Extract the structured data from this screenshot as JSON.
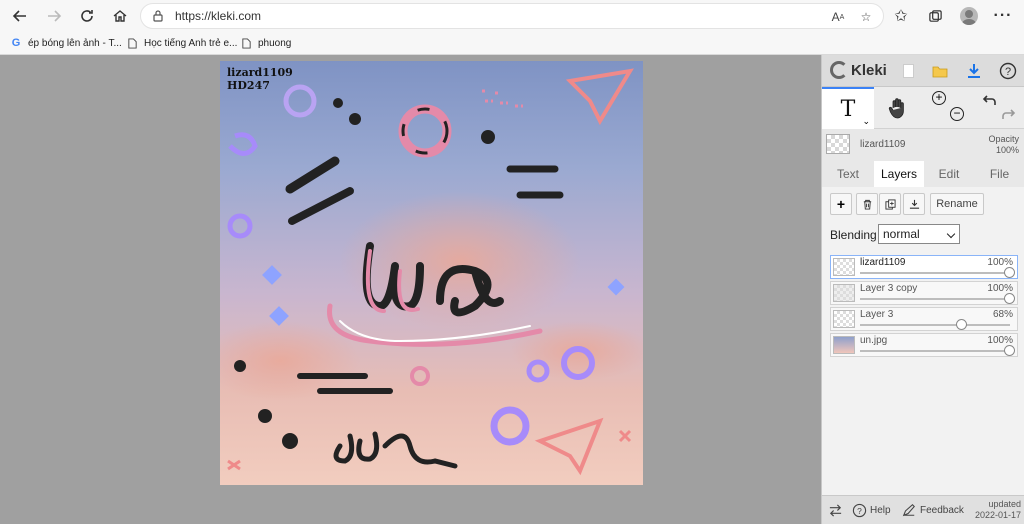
{
  "browser": {
    "url": "https://kleki.com",
    "bookmarks": [
      {
        "label": "ép bóng lên ảnh - T...",
        "icon": "google-icon"
      },
      {
        "label": "Học tiếng Anh trẻ e...",
        "icon": "page-icon"
      },
      {
        "label": "phuong",
        "icon": "page-icon"
      }
    ]
  },
  "canvas": {
    "watermark_line1": "lizard1109",
    "watermark_line2": "HD247"
  },
  "panel": {
    "brand": "Kleki",
    "current_layer": {
      "name": "lizard1109",
      "opacity_label": "Opacity",
      "opacity_value": "100%"
    },
    "tabs": [
      "Text",
      "Layers",
      "Edit",
      "File"
    ],
    "active_tab": "Layers",
    "rename_label": "Rename",
    "blending_label": "Blending",
    "blending_value": "normal",
    "layers": [
      {
        "name": "lizard1109",
        "opacity": "100%",
        "opacity_fraction": 1.0,
        "selected": true
      },
      {
        "name": "Layer 3 copy",
        "opacity": "100%",
        "opacity_fraction": 1.0,
        "selected": false
      },
      {
        "name": "Layer 3",
        "opacity": "68%",
        "opacity_fraction": 0.68,
        "selected": false
      },
      {
        "name": "un.jpg",
        "opacity": "100%",
        "opacity_fraction": 1.0,
        "selected": false
      }
    ],
    "footer": {
      "help_label": "Help",
      "feedback_label": "Feedback",
      "updated_label": "updated",
      "updated_date": "2022-01-17"
    }
  },
  "colors": {
    "accent": "#3b82f6",
    "sky_top": "#7f93c4",
    "sky_bottom": "#f2cdbf",
    "pink": "#e88aa8",
    "purple": "#a78bfa"
  }
}
